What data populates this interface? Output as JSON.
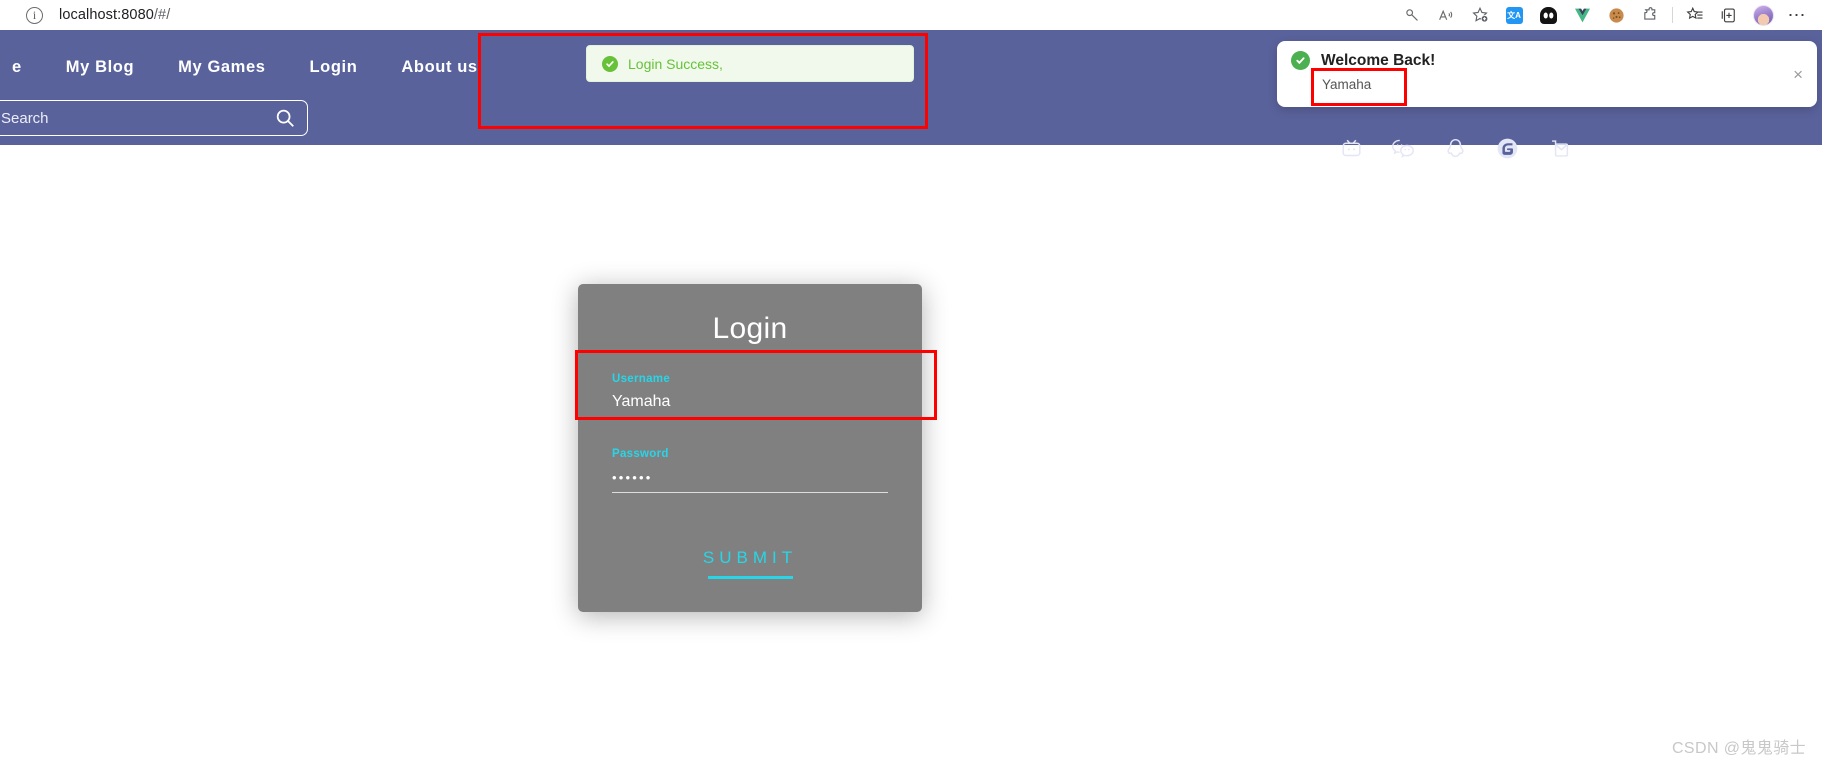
{
  "browser": {
    "url_host": "localhost:8080",
    "url_path": "/#/",
    "info_icon": "info-icon",
    "icons": [
      {
        "name": "key-icon",
        "glyph": "key"
      },
      {
        "name": "read-aloud-icon",
        "glyph": "A-sound"
      },
      {
        "name": "add-favorite-icon",
        "glyph": "star-plus"
      },
      {
        "name": "extension-translate-icon",
        "glyph": "blue-square",
        "color": "#2196f3"
      },
      {
        "name": "extension-dark-reader-icon",
        "glyph": "black-rounded",
        "color": "#111111"
      },
      {
        "name": "extension-vue-devtools-icon",
        "glyph": "vue-v",
        "color": "#42b883"
      },
      {
        "name": "extension-cookie-icon",
        "glyph": "cookie",
        "color": "#c98b4b"
      },
      {
        "name": "extension-puzzle-icon",
        "glyph": "puzzle",
        "color": "#5f6368"
      },
      {
        "name": "collections-icon",
        "glyph": "star-lines"
      },
      {
        "name": "split-screen-icon",
        "glyph": "tab-plus"
      },
      {
        "name": "profile-avatar",
        "glyph": "avatar"
      },
      {
        "name": "browser-settings-icon",
        "glyph": "ellipsis"
      }
    ]
  },
  "navbar": {
    "background": "#5a629c",
    "links": [
      {
        "label": "e"
      },
      {
        "label": "My Blog"
      },
      {
        "label": "My Games"
      },
      {
        "label": "Login"
      },
      {
        "label": "About us"
      }
    ],
    "search": {
      "placeholder": "Search",
      "value": "",
      "button_icon": "search-icon"
    },
    "social_icons": [
      {
        "name": "bilibili-icon"
      },
      {
        "name": "wechat-icon"
      },
      {
        "name": "qq-icon"
      },
      {
        "name": "gitee-icon"
      },
      {
        "name": "email-icon"
      }
    ]
  },
  "toast": {
    "message": "Login Success,",
    "icon": "success-check-icon",
    "text_color": "#67c23a",
    "background": "#f0f9eb"
  },
  "welcome_panel": {
    "title": "Welcome Back!",
    "body": "Yamaha",
    "icon": "success-check-icon",
    "close_label": "×"
  },
  "login_card": {
    "title": "Login",
    "username": {
      "label": "Username",
      "value": "Yamaha"
    },
    "password": {
      "label": "Password",
      "value": "••••••"
    },
    "submit_label": "SUBMIT",
    "accent_color": "#26d6e8",
    "card_color": "#808080"
  },
  "annotations": [
    {
      "name": "annotation-toast-area"
    },
    {
      "name": "annotation-welcome-username"
    },
    {
      "name": "annotation-username-field"
    }
  ],
  "watermark": {
    "text": "CSDN @鬼鬼骑士"
  }
}
